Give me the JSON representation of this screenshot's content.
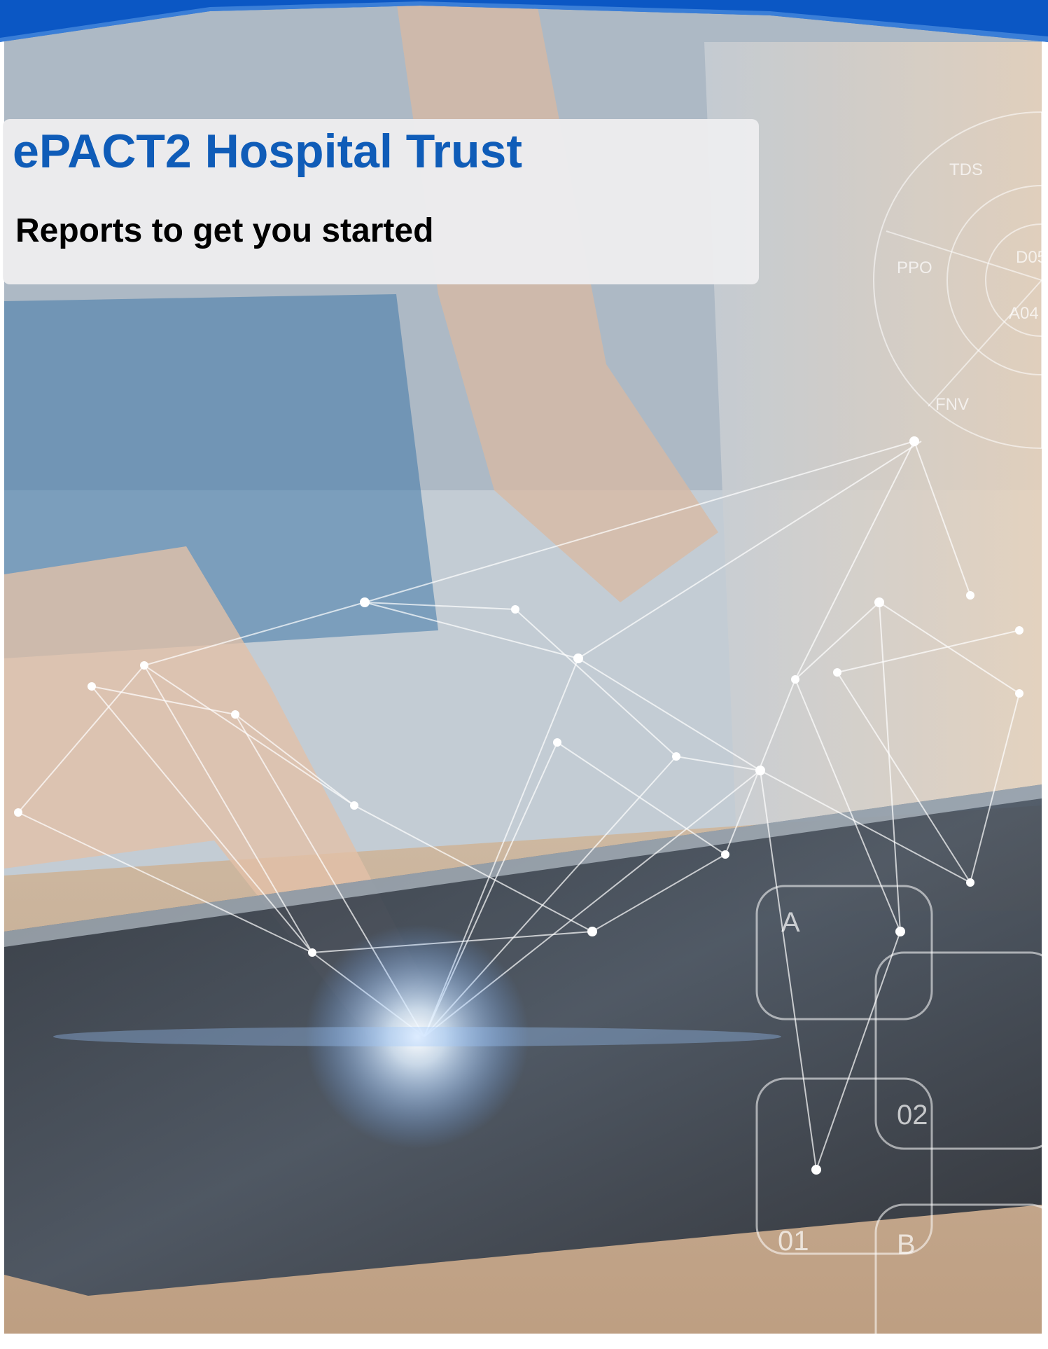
{
  "document": {
    "title": "ePACT2 Hospital Trust",
    "subtitle": "Reports to get you started"
  },
  "colors": {
    "title_blue": "#0f5cb8",
    "band_blue": "#0b57c4",
    "panel_grey": "#ececee",
    "subtitle_black": "#000000"
  },
  "cover_photo": {
    "icon": "network-tablet-photo-icon",
    "overlay_labels": [
      "TDS",
      "PPO",
      "D05",
      "A04",
      "FNV",
      "A",
      "02",
      "01",
      "B"
    ]
  }
}
